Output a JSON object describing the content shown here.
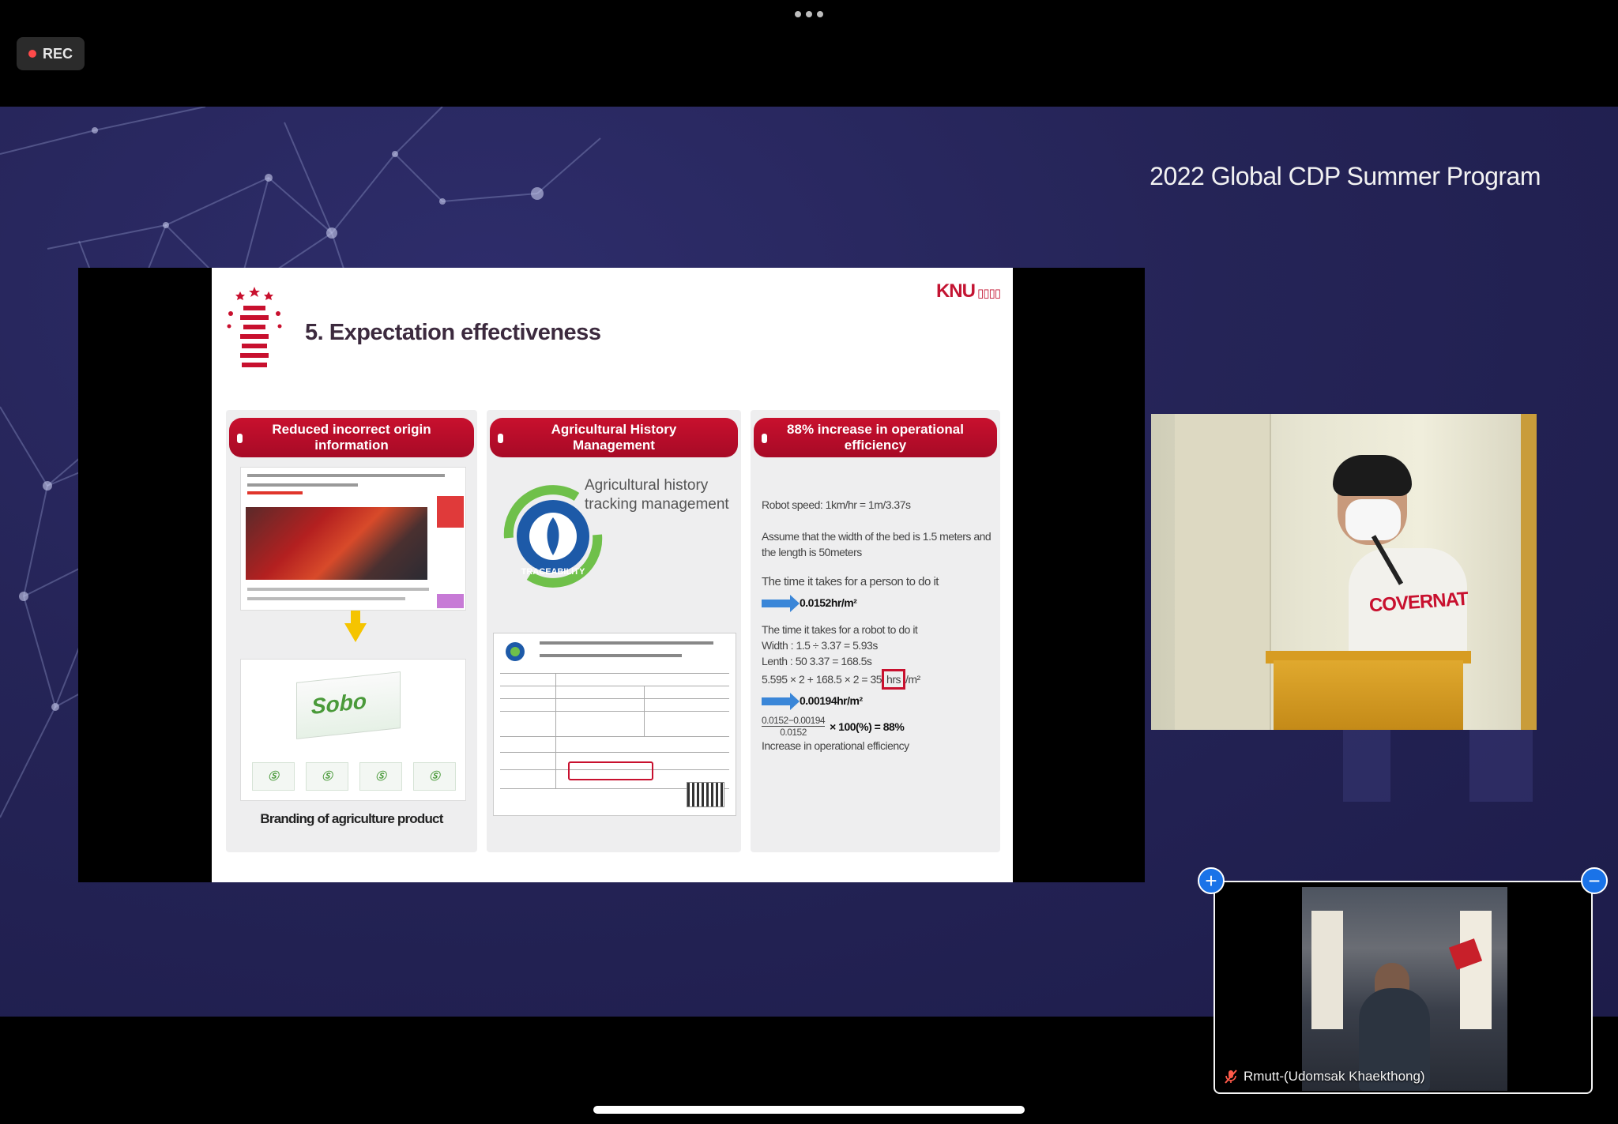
{
  "topbar": {
    "more_icon": "ellipsis-icon",
    "rec_label": "REC",
    "rec_color": "#ff4a4a"
  },
  "stage": {
    "event_title": "2022 Global CDP Summer Program",
    "bg_color": "#252457"
  },
  "slide": {
    "title": "5. Expectation effectiveness",
    "brand_logo": "KNU",
    "columns": [
      {
        "header": "Reduced incorrect origin information",
        "caption": "Branding of agriculture product",
        "package_label": "Sobo"
      },
      {
        "header": "Agricultural History Management",
        "text": "Agricultural history tracking management",
        "logo_text": "TRACEABILITY"
      },
      {
        "header": "88% increase in operational efficiency",
        "lines": {
          "robot_speed": "Robot speed: 1km/hr = 1m/3.37s",
          "assume": "Assume that the width of the bed is 1.5 meters and the length is 50meters",
          "person_time_label": "The time it takes for a person to do it",
          "person_time_value": "0.0152hr/m²",
          "robot_time_label": "The time it takes for a robot to do it",
          "width_calc": "Width : 1.5 ÷ 3.37 = 5.93s",
          "length_calc": "Lenth : 50 3.37 = 168.5s",
          "sum_calc_prefix": "5.595 × 2 + 168.5 × 2 = 35",
          "sum_calc_boxed": "hrs",
          "sum_calc_suffix": "/m²",
          "robot_time_value": "0.00194hr/m²",
          "formula_top": "0.0152−0.00194",
          "formula_bottom": "0.0152",
          "formula_result": "× 100(%) = 88%",
          "conclusion": "Increase in operational efficiency"
        }
      }
    ],
    "accent_color": "#c8102e"
  },
  "speaker_video": {
    "shirt_print": "COVERNAT"
  },
  "self_view": {
    "name": "Rmutt-(Udomsak Khaekthong)",
    "muted_icon": "mic-muted-icon",
    "plus_label": "+",
    "minus_label": "−"
  }
}
